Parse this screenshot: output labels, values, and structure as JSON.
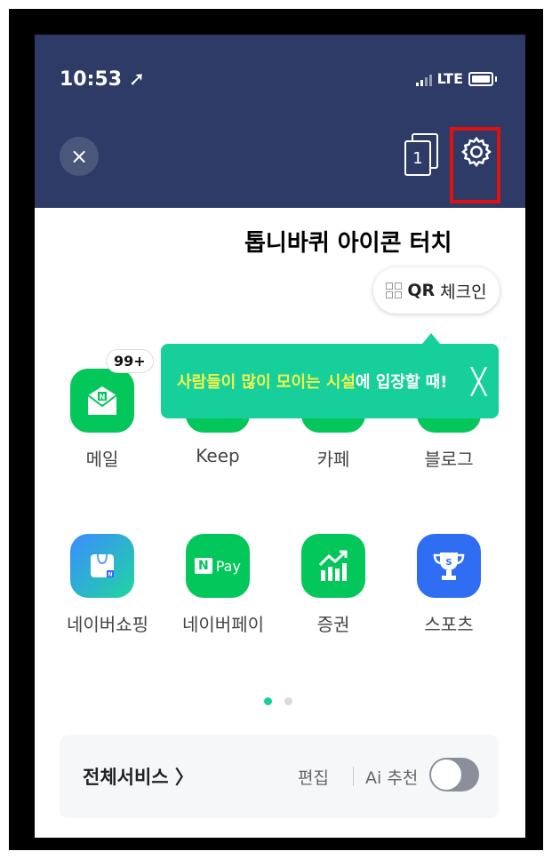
{
  "status_bar": {
    "time": "10:53",
    "network": "LTE"
  },
  "toolbar": {
    "close_label": "×",
    "tab_count": "1"
  },
  "instruction": "톱니바퀴 아이콘 터치",
  "qr_checkin": {
    "bold": "QR",
    "label": "체크인"
  },
  "tooltip": {
    "highlight": "사람들이 많이 모이는 시설",
    "rest": "에 입장할 때!",
    "close": "╳"
  },
  "apps": [
    {
      "label": "메일",
      "badge": "99+",
      "icon": "mail-icon"
    },
    {
      "label": "Keep",
      "icon": "keep-icon"
    },
    {
      "label": "카페",
      "icon": "cafe-icon"
    },
    {
      "label": "블로그",
      "icon": "blog-icon"
    },
    {
      "label": "네이버쇼핑",
      "icon": "shopping-icon"
    },
    {
      "label": "네이버페이",
      "icon": "pay-icon",
      "icon_text": "Pay"
    },
    {
      "label": "증권",
      "icon": "stock-icon"
    },
    {
      "label": "스포츠",
      "icon": "trophy-icon"
    }
  ],
  "bottom_bar": {
    "all_services": "전체서비스 〉",
    "edit": "편집",
    "ai_recommend": "Ai 추천"
  },
  "colors": {
    "header": "#2d3b66",
    "naver_green": "#03c75a",
    "tooltip": "#17cf9a",
    "highlight_box": "#e01010"
  }
}
